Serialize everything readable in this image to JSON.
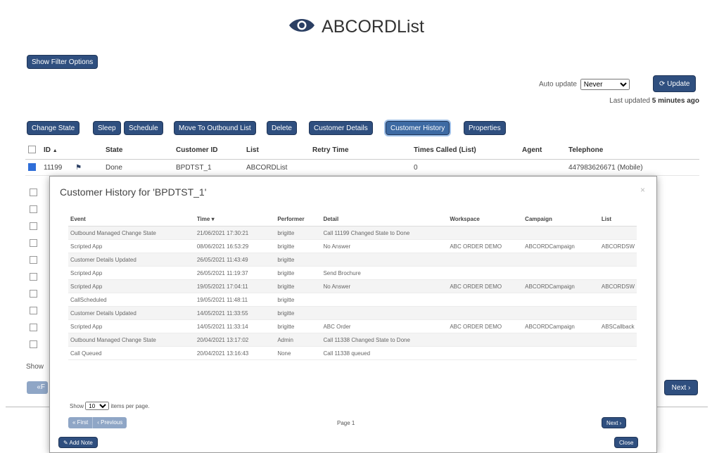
{
  "header": {
    "title": "ABCORDList",
    "icon": "eye-icon"
  },
  "filter": {
    "show_filter_label": "Show Filter Options"
  },
  "auto_update": {
    "label": "Auto update",
    "selected": "Never",
    "update_label": "Update",
    "last_updated_prefix": "Last updated",
    "last_updated_value": "5 minutes ago"
  },
  "toolbar": {
    "change_state": "Change State",
    "sleep": "Sleep",
    "schedule": "Schedule",
    "move_outbound": "Move To Outbound List",
    "delete": "Delete",
    "customer_details": "Customer Details",
    "customer_history": "Customer History",
    "properties": "Properties"
  },
  "table": {
    "columns": [
      "ID",
      "State",
      "Customer ID",
      "List",
      "Retry Time",
      "Times Called (List)",
      "Agent",
      "Telephone"
    ],
    "id_sort_glyph": "▲",
    "row": {
      "id": "11199",
      "state": "Done",
      "customer_id": "BPDTST_1",
      "list": "ABCORDList",
      "retry_time": "",
      "times_called": "0",
      "agent": "",
      "telephone": "447983626671 (Mobile)"
    }
  },
  "footer": {
    "show_text": "Show",
    "first_stub": "«F",
    "next_label": "Next ›"
  },
  "modal": {
    "title": "Customer History for 'BPDTST_1'",
    "close_x": "×",
    "columns": [
      "Event",
      "Time ▾",
      "Performer",
      "Detail",
      "Workspace",
      "Campaign",
      "List"
    ],
    "rows": [
      [
        "Outbound Managed Change State",
        "21/06/2021 17:30:21",
        "brigitte",
        "Call 11199 Changed State to Done",
        "",
        "",
        ""
      ],
      [
        "Scripted App",
        "08/06/2021 16:53:29",
        "brigitte",
        "No Answer",
        "ABC ORDER DEMO",
        "ABCORDCampaign",
        "ABCORDSW"
      ],
      [
        "Customer Details Updated",
        "26/05/2021 11:43:49",
        "brigitte",
        "",
        "",
        "",
        ""
      ],
      [
        "Scripted App",
        "26/05/2021 11:19:37",
        "brigitte",
        "Send Brochure",
        "",
        "",
        ""
      ],
      [
        "Scripted App",
        "19/05/2021 17:04:11",
        "brigitte",
        "No Answer",
        "ABC ORDER DEMO",
        "ABCORDCampaign",
        "ABCORDSW"
      ],
      [
        "CallScheduled",
        "19/05/2021 11:48:11",
        "brigitte",
        "",
        "",
        "",
        ""
      ],
      [
        "Customer Details Updated",
        "14/05/2021 11:33:55",
        "brigitte",
        "",
        "",
        "",
        ""
      ],
      [
        "Scripted App",
        "14/05/2021 11:33:14",
        "brigitte",
        "ABC Order",
        "ABC ORDER DEMO",
        "ABCORDCampaign",
        "ABSCallback"
      ],
      [
        "Outbound Managed Change State",
        "20/04/2021 13:17:02",
        "Admin",
        "Call 11338 Changed State to Done",
        "",
        "",
        ""
      ],
      [
        "Call Queued",
        "20/04/2021 13:16:43",
        "None",
        "Call 11338 queued",
        "",
        "",
        ""
      ]
    ],
    "show_label": "Show",
    "per_page": "10",
    "items_per_page": "items per page.",
    "first_label": "« First",
    "previous_label": "‹ Previous",
    "page_label": "Page 1",
    "next_label": "Next ›",
    "add_note_label": "Add Note",
    "close_label": "Close"
  }
}
